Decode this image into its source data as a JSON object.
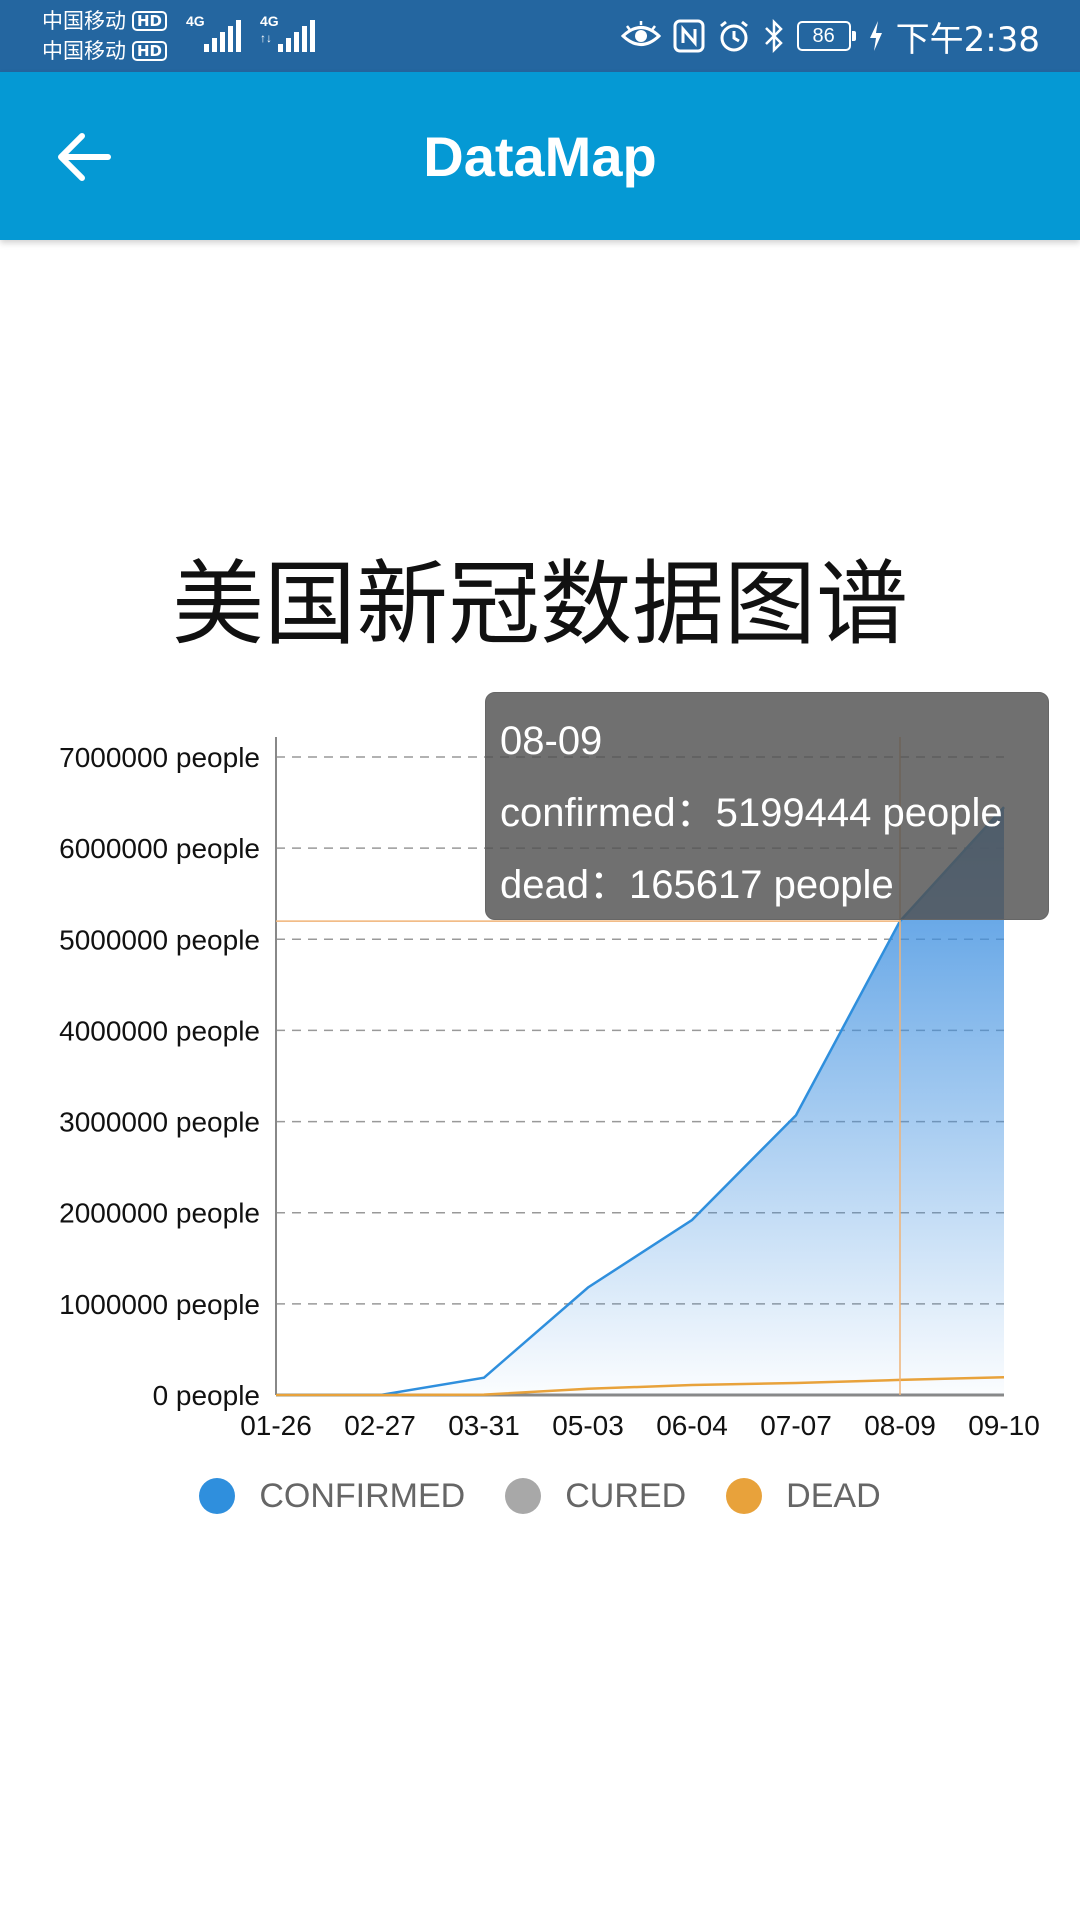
{
  "status_bar": {
    "carrier_1": "中国移动",
    "carrier_2": "中国移动",
    "hd_badge": "HD",
    "network_1": "4G",
    "network_2": "4G",
    "network_2_sub": "↑↓",
    "battery_level": "86",
    "time": "下午2:38"
  },
  "app_bar": {
    "title": "DataMap",
    "back_icon": "arrow-back-icon"
  },
  "chart_title": "美国新冠数据图谱",
  "chart_data": {
    "type": "area",
    "title": "美国新冠数据图谱",
    "categories": [
      "01-26",
      "02-27",
      "03-31",
      "05-03",
      "06-04",
      "07-07",
      "08-09",
      "09-10"
    ],
    "y_tick_labels": [
      "0 people",
      "1000000 people",
      "2000000 people",
      "3000000 people",
      "4000000 people",
      "5000000 people",
      "6000000 people",
      "7000000 people"
    ],
    "ylim": [
      0,
      7000000
    ],
    "grid": true,
    "series": [
      {
        "name": "CONFIRMED",
        "color": "#2f8fdd",
        "values": [
          5,
          15,
          190000,
          1180000,
          1920000,
          3070000,
          5199444,
          6450000
        ]
      },
      {
        "name": "CURED",
        "color": "#a8a8a8",
        "values": []
      },
      {
        "name": "DEAD",
        "color": "#e8a23b",
        "values": [
          0,
          0,
          4500,
          68000,
          110000,
          132000,
          165617,
          195000
        ]
      }
    ],
    "legend_position": "bottom"
  },
  "tooltip": {
    "date": "08-09",
    "confirmed_line": "confirmed：5199444 people",
    "dead_line": "dead：165617 people"
  },
  "legend": [
    {
      "label": "CONFIRMED",
      "color": "#2f8fdd"
    },
    {
      "label": "CURED",
      "color": "#a8a8a8"
    },
    {
      "label": "DEAD",
      "color": "#e8a23b"
    }
  ]
}
